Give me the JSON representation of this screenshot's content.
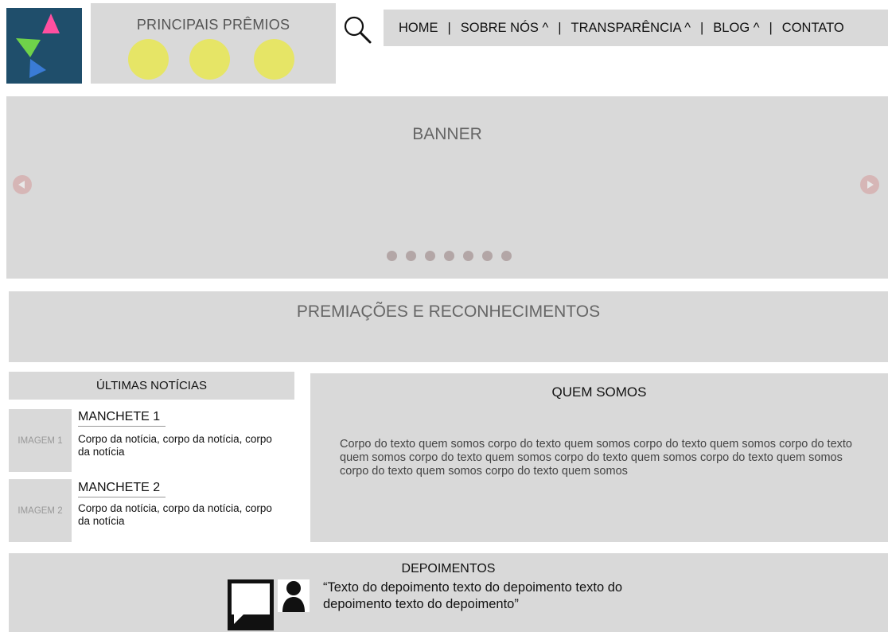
{
  "header": {
    "logo_name": "logo",
    "awards": {
      "title": "PRINCIPAIS PRÊMIOS",
      "badge_color": "#e6e566",
      "badge_count": 3
    },
    "search_icon": "search-icon",
    "nav": {
      "home": "HOME",
      "sobre": "SOBRE NÓS ^",
      "transparencia": "TRANSPARÊNCIA ^",
      "blog": "BLOG ^",
      "contato": "CONTATO",
      "separator": "|"
    }
  },
  "banner": {
    "label": "BANNER",
    "dot_count": 7,
    "prev_icon": "arrow-left-icon",
    "next_icon": "arrow-right-icon"
  },
  "premiacoes": {
    "label": "PREMIAÇÕES E RECONHECIMENTOS"
  },
  "news": {
    "header": "ÚLTIMAS NOTÍCIAS",
    "items": [
      {
        "image_label": "IMAGEM 1",
        "headline": "MANCHETE 1",
        "body": "Corpo da notícia, corpo da notícia, corpo da notícia"
      },
      {
        "image_label": "IMAGEM 2",
        "headline": "MANCHETE 2",
        "body": "Corpo da notícia, corpo da notícia, corpo da notícia"
      }
    ]
  },
  "quem_somos": {
    "title": "QUEM SOMOS",
    "body": "Corpo do texto quem somos corpo do texto quem somos corpo do texto quem somos corpo do texto quem somos corpo do texto quem somos corpo do texto quem somos corpo do texto quem somos corpo do texto quem somos corpo do texto quem somos"
  },
  "depoimentos": {
    "title": "DEPOIMENTOS",
    "quote": "“Texto do depoimento texto do depoimento texto do depoimento texto do depoimento”"
  },
  "colors": {
    "panel": "#d9d9d9",
    "logo_bg": "#1f4e6b",
    "badge": "#e6e566",
    "dot": "#b3a6a6",
    "arrow": "#d6b6b6"
  }
}
